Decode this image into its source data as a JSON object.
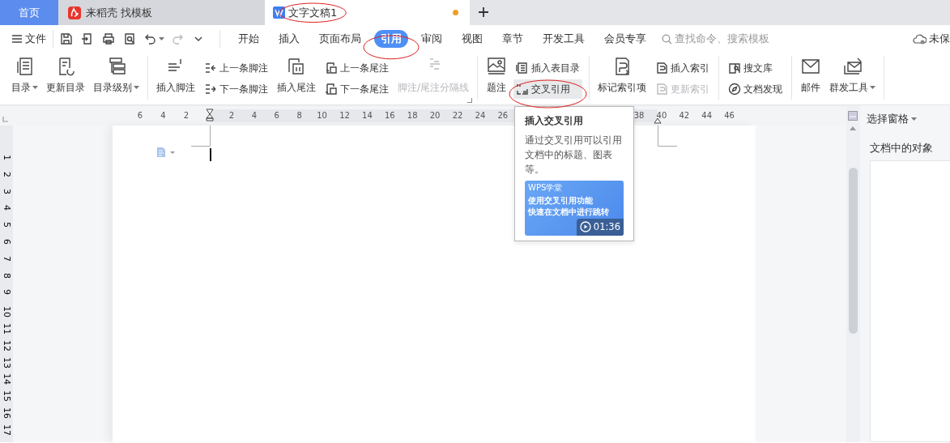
{
  "tabs": [
    {
      "label": "首页",
      "kind": "home",
      "selected": false,
      "unsaved": false,
      "annotated": false
    },
    {
      "label": "来稻壳 找模板",
      "kind": "docer",
      "selected": false,
      "unsaved": false,
      "annotated": false
    },
    {
      "label": "文字文稿1",
      "kind": "document",
      "selected": true,
      "unsaved": true,
      "annotated": true
    }
  ],
  "menu": {
    "file": "文件",
    "tabs": [
      {
        "label": "开始",
        "selected": false,
        "annotated": false
      },
      {
        "label": "插入",
        "selected": false,
        "annotated": false
      },
      {
        "label": "页面布局",
        "selected": false,
        "annotated": false
      },
      {
        "label": "引用",
        "selected": true,
        "annotated": true
      },
      {
        "label": "审阅",
        "selected": false,
        "annotated": false
      },
      {
        "label": "视图",
        "selected": false,
        "annotated": false
      },
      {
        "label": "章节",
        "selected": false,
        "annotated": false
      },
      {
        "label": "开发工具",
        "selected": false,
        "annotated": false
      },
      {
        "label": "会员专享",
        "selected": false,
        "annotated": false
      }
    ],
    "search": {
      "placeholder": "查找命令、搜索模板"
    },
    "cloud_status": "未保"
  },
  "ribbon": {
    "groups": [
      {
        "launcher": false,
        "items": [
          {
            "kind": "large",
            "label": "目录",
            "dropdown": true,
            "disabled": false
          },
          {
            "kind": "large",
            "label": "更新目录",
            "dropdown": false,
            "disabled": false
          },
          {
            "kind": "large",
            "label": "目录级别",
            "dropdown": true,
            "disabled": false
          }
        ]
      },
      {
        "launcher": true,
        "items": [
          {
            "kind": "large",
            "label": "插入脚注",
            "dropdown": false,
            "disabled": false
          },
          {
            "kind": "stack",
            "items": [
              {
                "label": "上一条脚注",
                "disabled": false,
                "hovered": false,
                "annotated": false
              },
              {
                "label": "下一条脚注",
                "disabled": false,
                "hovered": false,
                "annotated": false
              }
            ]
          },
          {
            "kind": "large",
            "label": "插入尾注",
            "dropdown": false,
            "disabled": false
          },
          {
            "kind": "stack",
            "items": [
              {
                "label": "上一条尾注",
                "disabled": false,
                "hovered": false,
                "annotated": false
              },
              {
                "label": "下一条尾注",
                "disabled": false,
                "hovered": false,
                "annotated": false
              }
            ]
          },
          {
            "kind": "large",
            "label": "脚注/尾注分隔线",
            "dropdown": false,
            "disabled": true
          }
        ]
      },
      {
        "launcher": false,
        "items": [
          {
            "kind": "large",
            "label": "题注",
            "dropdown": false,
            "disabled": false
          },
          {
            "kind": "stack",
            "items": [
              {
                "label": "插入表目录",
                "disabled": false,
                "hovered": false,
                "annotated": false
              },
              {
                "label": "交叉引用",
                "disabled": false,
                "hovered": true,
                "annotated": true
              }
            ]
          }
        ]
      },
      {
        "launcher": false,
        "items": [
          {
            "kind": "large",
            "label": "标记索引项",
            "dropdown": false,
            "disabled": false
          },
          {
            "kind": "stack",
            "items": [
              {
                "label": "插入索引",
                "disabled": false,
                "hovered": false,
                "annotated": false
              },
              {
                "label": "更新索引",
                "disabled": true,
                "hovered": false,
                "annotated": false
              }
            ]
          }
        ]
      },
      {
        "launcher": false,
        "items": [
          {
            "kind": "stack",
            "items": [
              {
                "label": "搜文库",
                "disabled": false,
                "hovered": false,
                "annotated": false
              },
              {
                "label": "文档发现",
                "disabled": false,
                "hovered": false,
                "annotated": false
              }
            ]
          }
        ]
      },
      {
        "launcher": false,
        "items": [
          {
            "kind": "large",
            "label": "邮件",
            "dropdown": false,
            "disabled": false
          },
          {
            "kind": "large",
            "label": "群发工具",
            "dropdown": true,
            "disabled": false
          }
        ]
      }
    ]
  },
  "ruler": {
    "segments": [
      [
        "6",
        "4",
        "2"
      ],
      [
        "2",
        "4",
        "6",
        "8",
        "10",
        "12",
        "14",
        "16",
        "18",
        "20",
        "22",
        "24",
        "26"
      ],
      [
        "38",
        "40",
        "42",
        "44",
        "46"
      ]
    ]
  },
  "vertical_ruler": [
    "1",
    "2",
    "3",
    "4",
    "5",
    "6",
    "7",
    "8",
    "9",
    "10",
    "11",
    "12",
    "13",
    "14",
    "15",
    "16",
    "17"
  ],
  "tooltip": {
    "title": "插入交叉引用",
    "body": "通过交叉引用可以引用文档中的标题、图表等。",
    "video": {
      "brand": "WPS学堂",
      "lines": [
        "使用交叉引用功能",
        "快速在文档中进行跳转"
      ],
      "duration": "01:36"
    }
  },
  "side_panel": {
    "title": "选择窗格",
    "heading": "文档中的对象"
  }
}
